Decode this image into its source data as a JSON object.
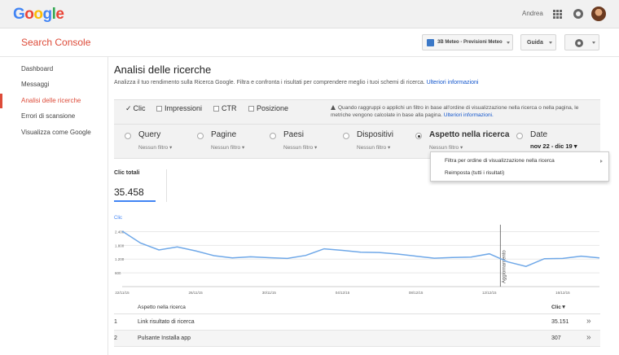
{
  "topbar": {
    "logo": [
      "G",
      "o",
      "o",
      "g",
      "l",
      "e"
    ],
    "user_name": "Andrea"
  },
  "header": {
    "app_title": "Search Console",
    "property": "3B Meteo - Previsioni Meteo",
    "guide_label": "Guida"
  },
  "sidebar": {
    "items": [
      {
        "label": "Dashboard",
        "active": false
      },
      {
        "label": "Messaggi",
        "active": false
      },
      {
        "label": "Analisi delle ricerche",
        "active": true
      },
      {
        "label": "Errori di scansione",
        "active": false
      },
      {
        "label": "Visualizza come Google",
        "active": false
      }
    ]
  },
  "main": {
    "title": "Analisi delle ricerche",
    "description": "Analizza il tuo rendimento sulla Ricerca Google. Filtra e confronta i risultati per comprendere meglio i tuoi schemi di ricerca.",
    "description_link": "Ulteriori informazioni",
    "metrics": [
      {
        "label": "Clic",
        "checked": true
      },
      {
        "label": "Impressioni",
        "checked": false
      },
      {
        "label": "CTR",
        "checked": false
      },
      {
        "label": "Posizione",
        "checked": false
      }
    ],
    "warning_text": "Quando raggruppi o applichi un filtro in base all'ordine di visualizzazione nella ricerca o nella pagina, le metriche vengono calcolate in base alla pagina.",
    "warning_link": "Ulteriori informazioni.",
    "dimensions": [
      {
        "label": "Query",
        "filter": "Nessun filtro",
        "selected": false
      },
      {
        "label": "Pagine",
        "filter": "Nessun filtro",
        "selected": false
      },
      {
        "label": "Paesi",
        "filter": "Nessun filtro",
        "selected": false
      },
      {
        "label": "Dispositivi",
        "filter": "Nessun filtro",
        "selected": false
      },
      {
        "label": "Aspetto nella ricerca",
        "filter": "Nessun filtro",
        "selected": true
      },
      {
        "label": "Date",
        "filter": "nov 22 - dic 19",
        "selected": false
      }
    ],
    "dropdown": {
      "items": [
        "Filtra per ordine di visualizzazione nella ricerca",
        "Reimposta (tutti i risultati)"
      ]
    },
    "total": {
      "label": "Clic totali",
      "value": "35.458"
    }
  },
  "chart_data": {
    "type": "line",
    "title": "",
    "ylabel": "Clic",
    "xlabel": "",
    "ylim": [
      0,
      2700
    ],
    "yticks": [
      "2.400",
      "1.800",
      "1.200",
      "600"
    ],
    "ytick_values": [
      2400,
      1800,
      1200,
      600
    ],
    "xticks": [
      "22/11/15",
      "26/11/15",
      "30/11/15",
      "04/12/15",
      "08/12/15",
      "12/12/15",
      "16/12/15"
    ],
    "annotation": "Aggiornamento",
    "annotation_index": 20.6,
    "grid": true,
    "series": [
      {
        "color": "#6fa8e8",
        "values": [
          2420,
          1900,
          1600,
          1730,
          1560,
          1350,
          1250,
          1300,
          1260,
          1230,
          1360,
          1650,
          1580,
          1500,
          1490,
          1420,
          1330,
          1240,
          1270,
          1290,
          1430,
          1080,
          880,
          1220,
          1230,
          1330,
          1250
        ]
      }
    ]
  },
  "table": {
    "columns": {
      "dimension": "Aspetto nella ricerca",
      "value": "Clic"
    },
    "sort_arrow": "▼",
    "rows": [
      {
        "index": "1",
        "label": "Link risultato di ricerca",
        "value": "35.151"
      },
      {
        "index": "2",
        "label": "Pulsante Installa app",
        "value": "307"
      }
    ]
  },
  "colors": {
    "accent_red": "#dd4b39",
    "link_blue": "#1155cc",
    "line_blue": "#6fa8e8"
  },
  "icons": {
    "apps": "apps-grid-icon",
    "notifications": "bell-icon",
    "settings": "gear-icon",
    "expand": "double-chevron-right-icon"
  }
}
